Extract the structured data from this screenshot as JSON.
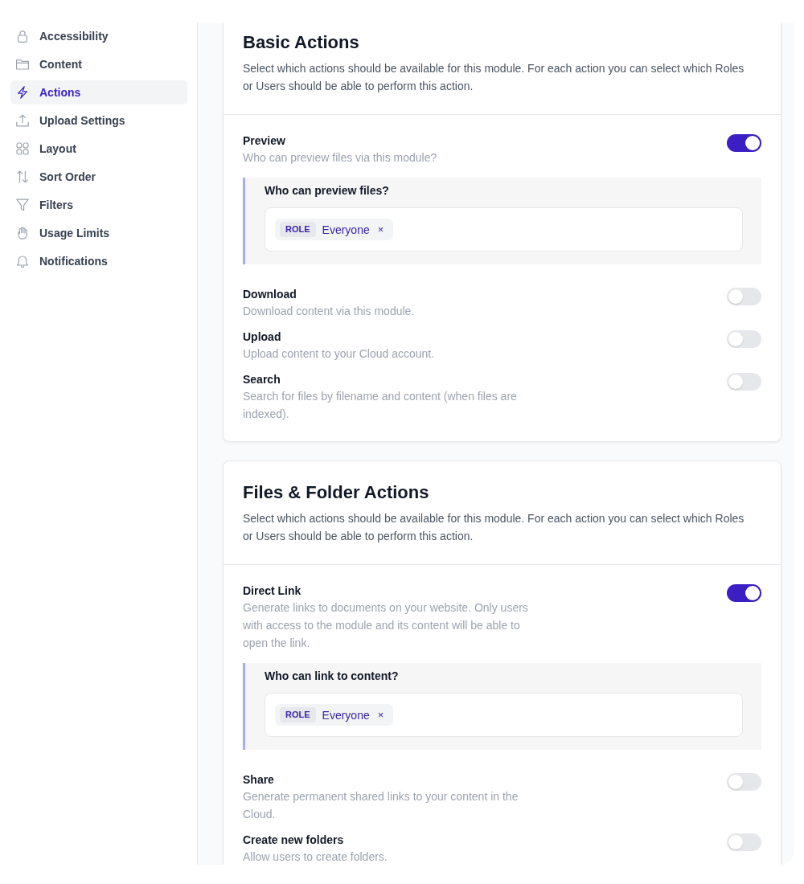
{
  "sidebar": {
    "items": [
      {
        "label": "Accessibility",
        "selected": false
      },
      {
        "label": "Content",
        "selected": false
      },
      {
        "label": "Actions",
        "selected": true
      },
      {
        "label": "Upload Settings",
        "selected": false
      },
      {
        "label": "Layout",
        "selected": false
      },
      {
        "label": "Sort Order",
        "selected": false
      },
      {
        "label": "Filters",
        "selected": false
      },
      {
        "label": "Usage Limits",
        "selected": false
      },
      {
        "label": "Notifications",
        "selected": false
      }
    ]
  },
  "sections": [
    {
      "title": "Basic Actions",
      "description": "Select which actions should be available for this module. For each action you can select which Roles or Users should be able to perform this action.",
      "actions": [
        {
          "title": "Preview",
          "description": "Who can preview files via this module?",
          "on": true,
          "permission": {
            "label": "Who can preview files?",
            "tags": [
              {
                "type": "ROLE",
                "name": "Everyone",
                "remove": "×"
              }
            ]
          }
        },
        {
          "title": "Download",
          "description": "Download content via this module.",
          "on": false
        },
        {
          "title": "Upload",
          "description": "Upload content to your Cloud account.",
          "on": false
        },
        {
          "title": "Search",
          "description": "Search for files by filename and content (when files are indexed).",
          "on": false
        }
      ]
    },
    {
      "title": "Files & Folder Actions",
      "description": "Select which actions should be available for this module. For each action you can select which Roles or Users should be able to perform this action.",
      "actions": [
        {
          "title": "Direct Link",
          "description": "Generate links to documents on your website. Only users with access to the module and its content will be able to open the link.",
          "on": true,
          "permission": {
            "label": "Who can link to content?",
            "tags": [
              {
                "type": "ROLE",
                "name": "Everyone",
                "remove": "×"
              }
            ]
          }
        },
        {
          "title": "Share",
          "description": "Generate permanent shared links to your content in the Cloud.",
          "on": false
        },
        {
          "title": "Create new folders",
          "description": "Allow users to create folders.",
          "on": false
        }
      ]
    }
  ]
}
